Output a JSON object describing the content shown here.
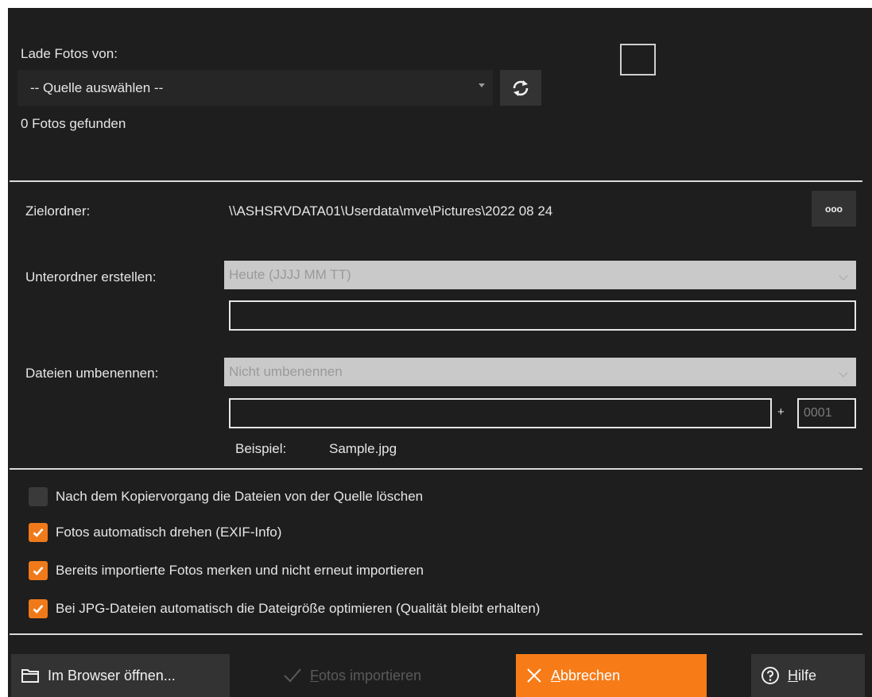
{
  "source": {
    "label": "Lade Fotos von:",
    "select_value": "-- Quelle auswählen --",
    "found_text": "0 Fotos gefunden"
  },
  "target": {
    "label": "Zielordner:",
    "path": "\\\\ASHSRVDATA01\\Userdata\\mve\\Pictures\\2022 08 24",
    "browse_label": "ooo"
  },
  "subfolder": {
    "label": "Unterordner erstellen:",
    "select_value": "Heute (JJJJ MM TT)",
    "text_value": ""
  },
  "rename": {
    "label": "Dateien umbenennen:",
    "select_value": "Nicht umbenennen",
    "name_value": "",
    "plus": "+",
    "counter_value": "0001",
    "example_label": "Beispiel:",
    "example_value": "Sample.jpg"
  },
  "options": [
    {
      "label": "Nach dem Kopiervorgang die Dateien von der Quelle löschen",
      "checked": false
    },
    {
      "label": "Fotos automatisch drehen (EXIF-Info)",
      "checked": true
    },
    {
      "label": "Bereits importierte Fotos merken und nicht erneut importieren",
      "checked": true
    },
    {
      "label": "Bei JPG-Dateien automatisch die Dateigröße optimieren (Qualität bleibt erhalten)",
      "checked": true
    }
  ],
  "footer": {
    "browser_label": "Im Browser öffnen...",
    "import_first": "F",
    "import_rest": "otos importieren",
    "cancel_first": "A",
    "cancel_rest": "bbrechen",
    "help_first": "H",
    "help_rest": "ilfe"
  },
  "colors": {
    "accent": "#f77b17",
    "background": "#1e1e1e"
  }
}
